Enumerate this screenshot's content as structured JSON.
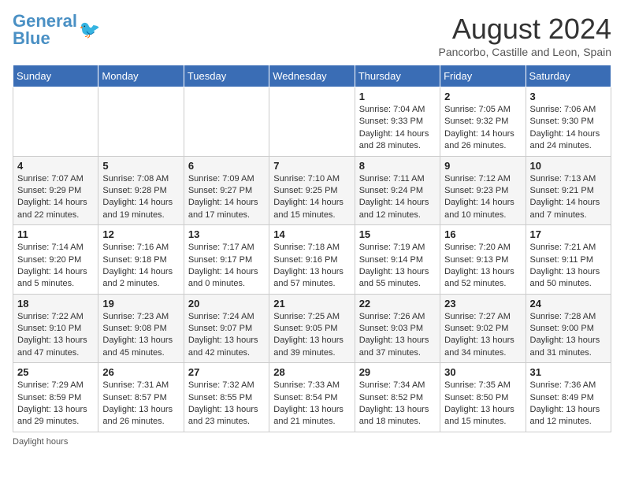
{
  "logo": {
    "line1": "General",
    "line2": "Blue"
  },
  "title": "August 2024",
  "location": "Pancorbo, Castille and Leon, Spain",
  "days_of_week": [
    "Sunday",
    "Monday",
    "Tuesday",
    "Wednesday",
    "Thursday",
    "Friday",
    "Saturday"
  ],
  "weeks": [
    [
      {
        "day": "",
        "info": ""
      },
      {
        "day": "",
        "info": ""
      },
      {
        "day": "",
        "info": ""
      },
      {
        "day": "",
        "info": ""
      },
      {
        "day": "1",
        "info": "Sunrise: 7:04 AM\nSunset: 9:33 PM\nDaylight: 14 hours\nand 28 minutes."
      },
      {
        "day": "2",
        "info": "Sunrise: 7:05 AM\nSunset: 9:32 PM\nDaylight: 14 hours\nand 26 minutes."
      },
      {
        "day": "3",
        "info": "Sunrise: 7:06 AM\nSunset: 9:30 PM\nDaylight: 14 hours\nand 24 minutes."
      }
    ],
    [
      {
        "day": "4",
        "info": "Sunrise: 7:07 AM\nSunset: 9:29 PM\nDaylight: 14 hours\nand 22 minutes."
      },
      {
        "day": "5",
        "info": "Sunrise: 7:08 AM\nSunset: 9:28 PM\nDaylight: 14 hours\nand 19 minutes."
      },
      {
        "day": "6",
        "info": "Sunrise: 7:09 AM\nSunset: 9:27 PM\nDaylight: 14 hours\nand 17 minutes."
      },
      {
        "day": "7",
        "info": "Sunrise: 7:10 AM\nSunset: 9:25 PM\nDaylight: 14 hours\nand 15 minutes."
      },
      {
        "day": "8",
        "info": "Sunrise: 7:11 AM\nSunset: 9:24 PM\nDaylight: 14 hours\nand 12 minutes."
      },
      {
        "day": "9",
        "info": "Sunrise: 7:12 AM\nSunset: 9:23 PM\nDaylight: 14 hours\nand 10 minutes."
      },
      {
        "day": "10",
        "info": "Sunrise: 7:13 AM\nSunset: 9:21 PM\nDaylight: 14 hours\nand 7 minutes."
      }
    ],
    [
      {
        "day": "11",
        "info": "Sunrise: 7:14 AM\nSunset: 9:20 PM\nDaylight: 14 hours\nand 5 minutes."
      },
      {
        "day": "12",
        "info": "Sunrise: 7:16 AM\nSunset: 9:18 PM\nDaylight: 14 hours\nand 2 minutes."
      },
      {
        "day": "13",
        "info": "Sunrise: 7:17 AM\nSunset: 9:17 PM\nDaylight: 14 hours\nand 0 minutes."
      },
      {
        "day": "14",
        "info": "Sunrise: 7:18 AM\nSunset: 9:16 PM\nDaylight: 13 hours\nand 57 minutes."
      },
      {
        "day": "15",
        "info": "Sunrise: 7:19 AM\nSunset: 9:14 PM\nDaylight: 13 hours\nand 55 minutes."
      },
      {
        "day": "16",
        "info": "Sunrise: 7:20 AM\nSunset: 9:13 PM\nDaylight: 13 hours\nand 52 minutes."
      },
      {
        "day": "17",
        "info": "Sunrise: 7:21 AM\nSunset: 9:11 PM\nDaylight: 13 hours\nand 50 minutes."
      }
    ],
    [
      {
        "day": "18",
        "info": "Sunrise: 7:22 AM\nSunset: 9:10 PM\nDaylight: 13 hours\nand 47 minutes."
      },
      {
        "day": "19",
        "info": "Sunrise: 7:23 AM\nSunset: 9:08 PM\nDaylight: 13 hours\nand 45 minutes."
      },
      {
        "day": "20",
        "info": "Sunrise: 7:24 AM\nSunset: 9:07 PM\nDaylight: 13 hours\nand 42 minutes."
      },
      {
        "day": "21",
        "info": "Sunrise: 7:25 AM\nSunset: 9:05 PM\nDaylight: 13 hours\nand 39 minutes."
      },
      {
        "day": "22",
        "info": "Sunrise: 7:26 AM\nSunset: 9:03 PM\nDaylight: 13 hours\nand 37 minutes."
      },
      {
        "day": "23",
        "info": "Sunrise: 7:27 AM\nSunset: 9:02 PM\nDaylight: 13 hours\nand 34 minutes."
      },
      {
        "day": "24",
        "info": "Sunrise: 7:28 AM\nSunset: 9:00 PM\nDaylight: 13 hours\nand 31 minutes."
      }
    ],
    [
      {
        "day": "25",
        "info": "Sunrise: 7:29 AM\nSunset: 8:59 PM\nDaylight: 13 hours\nand 29 minutes."
      },
      {
        "day": "26",
        "info": "Sunrise: 7:31 AM\nSunset: 8:57 PM\nDaylight: 13 hours\nand 26 minutes."
      },
      {
        "day": "27",
        "info": "Sunrise: 7:32 AM\nSunset: 8:55 PM\nDaylight: 13 hours\nand 23 minutes."
      },
      {
        "day": "28",
        "info": "Sunrise: 7:33 AM\nSunset: 8:54 PM\nDaylight: 13 hours\nand 21 minutes."
      },
      {
        "day": "29",
        "info": "Sunrise: 7:34 AM\nSunset: 8:52 PM\nDaylight: 13 hours\nand 18 minutes."
      },
      {
        "day": "30",
        "info": "Sunrise: 7:35 AM\nSunset: 8:50 PM\nDaylight: 13 hours\nand 15 minutes."
      },
      {
        "day": "31",
        "info": "Sunrise: 7:36 AM\nSunset: 8:49 PM\nDaylight: 13 hours\nand 12 minutes."
      }
    ]
  ],
  "footer": "Daylight hours"
}
